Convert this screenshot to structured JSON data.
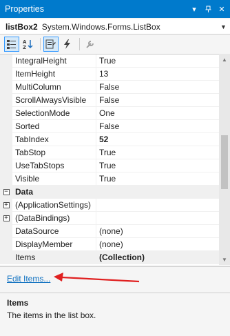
{
  "window": {
    "title": "Properties"
  },
  "object_selector": {
    "name": "listBox2",
    "type": "System.Windows.Forms.ListBox"
  },
  "toolbar": {
    "buttons": [
      {
        "name": "categorized-icon"
      },
      {
        "name": "alphabetical-icon"
      },
      {
        "name": "properties-icon"
      },
      {
        "name": "events-icon"
      },
      {
        "name": "property-pages-icon"
      }
    ]
  },
  "properties": [
    {
      "name": "IntegralHeight",
      "value": "True"
    },
    {
      "name": "ItemHeight",
      "value": "13"
    },
    {
      "name": "MultiColumn",
      "value": "False"
    },
    {
      "name": "ScrollAlwaysVisible",
      "value": "False"
    },
    {
      "name": "SelectionMode",
      "value": "One"
    },
    {
      "name": "Sorted",
      "value": "False"
    },
    {
      "name": "TabIndex",
      "value": "52"
    },
    {
      "name": "TabStop",
      "value": "True"
    },
    {
      "name": "UseTabStops",
      "value": "True"
    },
    {
      "name": "Visible",
      "value": "True"
    }
  ],
  "data_category": {
    "label": "Data",
    "rows": [
      {
        "name": "(ApplicationSettings)",
        "value": ""
      },
      {
        "name": "(DataBindings)",
        "value": ""
      },
      {
        "name": "DataSource",
        "value": "(none)"
      },
      {
        "name": "DisplayMember",
        "value": "(none)"
      },
      {
        "name": "Items",
        "value": "(Collection)"
      }
    ]
  },
  "commands": {
    "edit_items": "Edit Items..."
  },
  "description": {
    "title": "Items",
    "text": "The items in the list box."
  },
  "colors": {
    "titlebar": "#007acc",
    "link": "#0e70c0",
    "annotation_arrow": "#e02020"
  }
}
